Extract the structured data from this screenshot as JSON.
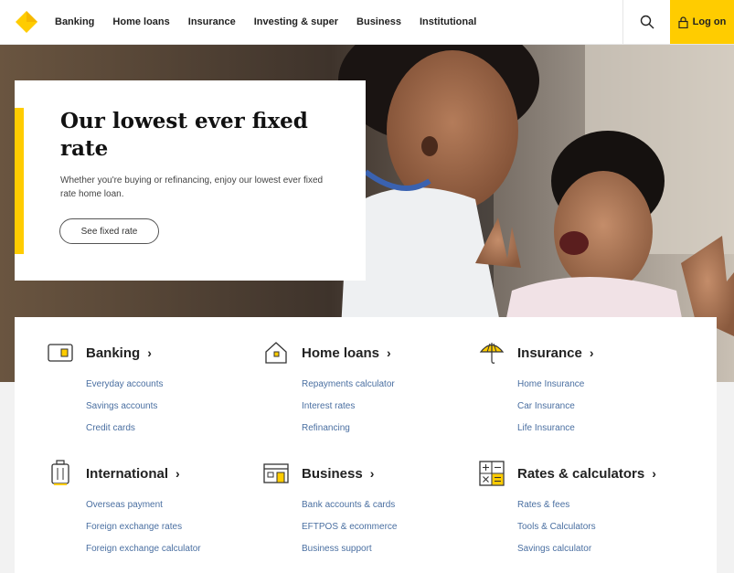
{
  "nav": {
    "links": [
      "Banking",
      "Home loans",
      "Insurance",
      "Investing & super",
      "Business",
      "Institutional"
    ],
    "logon_label": "Log on",
    "accent": "#ffcc00"
  },
  "hero": {
    "title": "Our lowest ever fixed rate",
    "text": "Whether you're buying or refinancing, enjoy our lowest ever fixed rate home loan.",
    "button": "See fixed rate"
  },
  "categories": [
    {
      "title": "Banking",
      "icon": "card-icon",
      "links": [
        "Everyday accounts",
        "Savings accounts",
        "Credit cards"
      ]
    },
    {
      "title": "Home loans",
      "icon": "house-icon",
      "links": [
        "Repayments calculator",
        "Interest rates",
        "Refinancing"
      ]
    },
    {
      "title": "Insurance",
      "icon": "umbrella-icon",
      "links": [
        "Home Insurance",
        "Car Insurance",
        "Life Insurance"
      ]
    },
    {
      "title": "International",
      "icon": "luggage-icon",
      "links": [
        "Overseas payment",
        "Foreign exchange rates",
        "Foreign exchange calculator"
      ]
    },
    {
      "title": "Business",
      "icon": "shopfront-icon",
      "links": [
        "Bank accounts & cards",
        "EFTPOS & ecommerce",
        "Business support"
      ]
    },
    {
      "title": "Rates & calculators",
      "icon": "calculator-icon",
      "links": [
        "Rates & fees",
        "Tools & Calculators",
        "Savings calculator"
      ]
    }
  ]
}
